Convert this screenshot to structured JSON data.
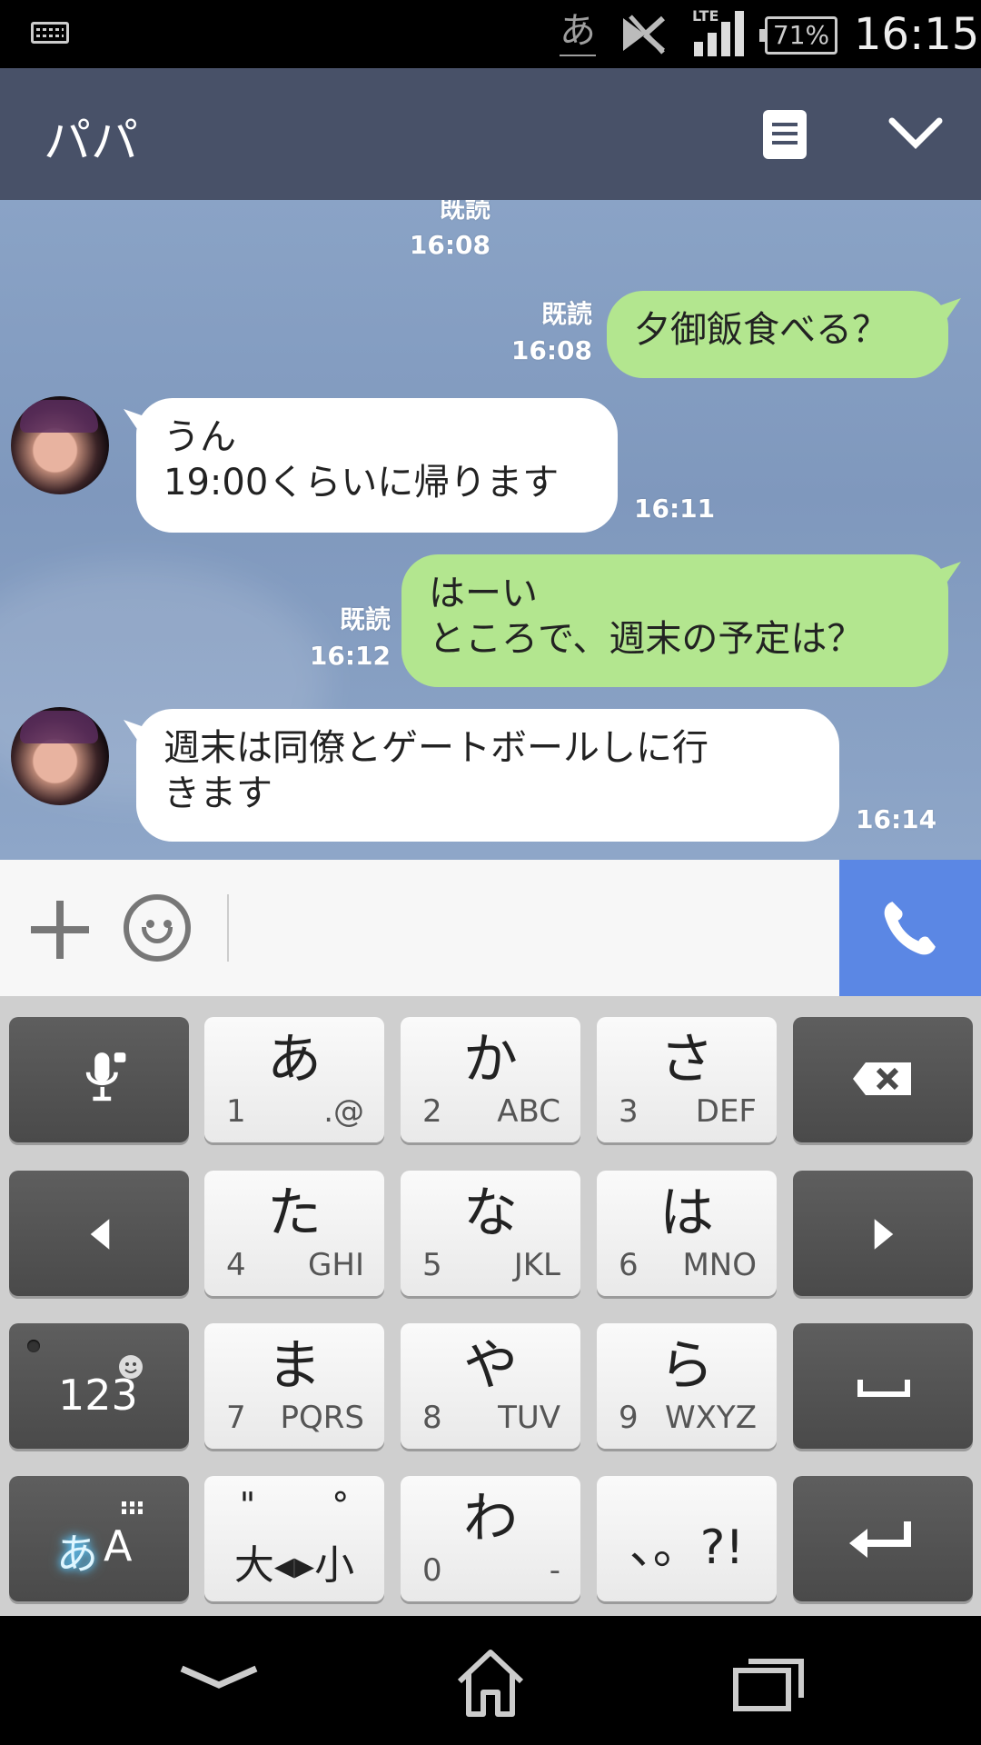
{
  "status_bar": {
    "ime_indicator": "あ",
    "network": "LTE",
    "battery": "71%",
    "time": "16:15",
    "icons": [
      "keyboard-icon",
      "nfc-icon",
      "signal-icon",
      "battery-icon"
    ]
  },
  "header": {
    "title": "パパ",
    "icons": [
      "memo-icon",
      "chevron-down-icon"
    ],
    "color": "#485168"
  },
  "messages": [
    {
      "dir": "out-partial",
      "read": "既読",
      "time": "16:08"
    },
    {
      "dir": "out",
      "text": "夕御飯食べる？",
      "read": "既読",
      "time": "16:08"
    },
    {
      "dir": "in",
      "line1": "うん",
      "line2": "19:00くらいに帰ります",
      "time": "16:11"
    },
    {
      "dir": "out",
      "line1": "はーい",
      "line2": "ところで、週末の予定は？",
      "read": "既読",
      "time": "16:12"
    },
    {
      "dir": "in",
      "line1": "週末は同僚とゲートボールしに行",
      "line2": "きます",
      "time": "16:14"
    }
  ],
  "input_bar": {
    "icons": [
      "plus-icon",
      "emoji-icon",
      "phone-icon"
    ],
    "call_color": "#5b87e4"
  },
  "keyboard": {
    "k_a": {
      "main": "あ",
      "num": "1",
      "sub": ".@"
    },
    "k_ka": {
      "main": "か",
      "num": "2",
      "sub": "ABC"
    },
    "k_sa": {
      "main": "さ",
      "num": "3",
      "sub": "DEF"
    },
    "k_ta": {
      "main": "た",
      "num": "4",
      "sub": "GHI"
    },
    "k_na": {
      "main": "な",
      "num": "5",
      "sub": "JKL"
    },
    "k_ha": {
      "main": "は",
      "num": "6",
      "sub": "MNO"
    },
    "k_ma": {
      "main": "ま",
      "num": "7",
      "sub": "PQRS"
    },
    "k_ya": {
      "main": "や",
      "num": "8",
      "sub": "TUV"
    },
    "k_ra": {
      "main": "ら",
      "num": "9",
      "sub": "WXYZ"
    },
    "k_dakuten": {
      "top": "\" °",
      "main": "大◂▸小"
    },
    "k_wa": {
      "main": "わ",
      "num": "0",
      "sub": "-"
    },
    "k_punct": {
      "main": "、。?!"
    },
    "k_123": {
      "main": "123"
    },
    "k_mode": {
      "main1": "あ",
      "main2": "A"
    }
  },
  "nav_bar": {
    "icons": [
      "back-icon",
      "home-icon",
      "recents-icon"
    ]
  }
}
